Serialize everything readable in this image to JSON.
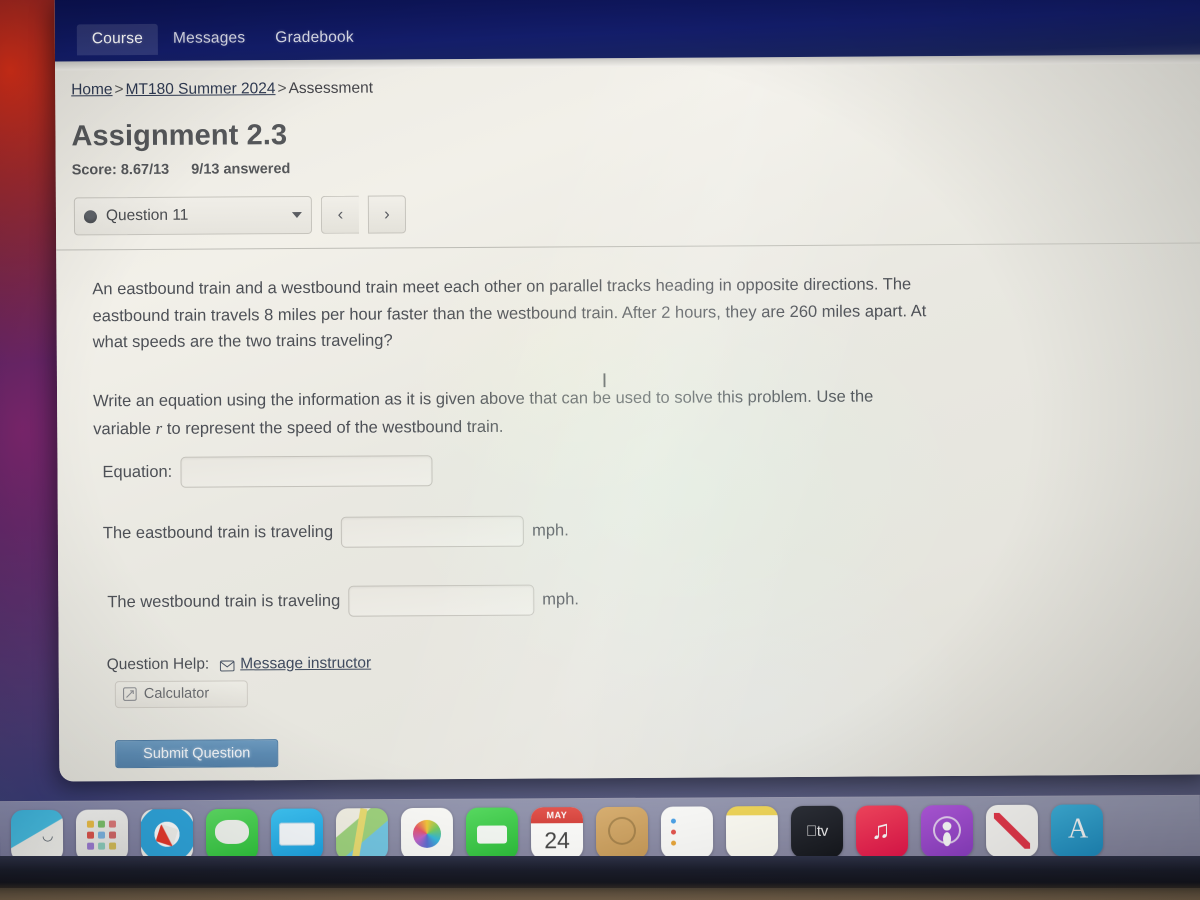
{
  "topnav": {
    "tabs": [
      {
        "label": "Course",
        "active": true
      },
      {
        "label": "Messages",
        "active": false
      },
      {
        "label": "Gradebook",
        "active": false
      }
    ]
  },
  "breadcrumb": {
    "home": "Home",
    "course": "MT180 Summer 2024",
    "current": "Assessment",
    "separator": ">"
  },
  "assignment": {
    "title": "Assignment 2.3",
    "score_label": "Score: 8.67/13",
    "answered_label": "9/13 answered"
  },
  "question_nav": {
    "selected_question": "Question 11",
    "prev_label": "‹",
    "next_label": "›",
    "dropdown_icon": "chevron-down-icon",
    "status_icon": "partial-credit-dot-icon"
  },
  "question": {
    "prompt_line_1": "An eastbound train and a westbound train meet each other on parallel tracks heading in",
    "prompt_line_2": "opposite directions. The eastbound train travels 8 miles per hour faster than the westbound",
    "prompt_line_3": "train. After 2 hours, they are 260 miles apart. At what speeds are the two trains traveling?",
    "instruction_part_1": "Write an equation using the information as it is given above that can be used to solve this problem. Use the variable ",
    "instruction_variable": "r",
    "instruction_part_2": " to represent the speed of the westbound train.",
    "equation_label": "Equation:",
    "equation_value": "",
    "equation_placeholder": "",
    "eastbound_label": "The eastbound train is traveling",
    "eastbound_value": "",
    "eastbound_unit": "mph.",
    "westbound_label": "The westbound train is traveling",
    "westbound_value": "",
    "westbound_unit": "mph.",
    "cursor_glyph": "I"
  },
  "help": {
    "help_label": "Question Help:",
    "message_instructor_label": "Message instructor",
    "message_icon": "envelope-icon",
    "calculator_label": "Calculator",
    "calculator_icon": "popout-square-icon"
  },
  "actions": {
    "submit_label": "Submit Question",
    "submit_color": "#5d8cb4"
  },
  "dock": {
    "items": [
      {
        "name": "finder",
        "label": "Finder",
        "icon": "finder-icon"
      },
      {
        "name": "launchpad",
        "label": "Launchpad",
        "icon": "launchpad-icon"
      },
      {
        "name": "safari",
        "label": "Safari",
        "icon": "safari-icon"
      },
      {
        "name": "messages",
        "label": "Messages",
        "icon": "messages-icon"
      },
      {
        "name": "mail",
        "label": "Mail",
        "icon": "mail-icon"
      },
      {
        "name": "maps",
        "label": "Maps",
        "icon": "maps-icon"
      },
      {
        "name": "photos",
        "label": "Photos",
        "icon": "photos-icon"
      },
      {
        "name": "facetime",
        "label": "FaceTime",
        "icon": "facetime-icon"
      },
      {
        "name": "calendar",
        "label": "Calendar",
        "icon": "calendar-icon",
        "month": "MAY",
        "day": "24"
      },
      {
        "name": "contacts",
        "label": "Contacts",
        "icon": "contacts-icon"
      },
      {
        "name": "reminders",
        "label": "Reminders",
        "icon": "reminders-icon"
      },
      {
        "name": "notes",
        "label": "Notes",
        "icon": "notes-icon"
      },
      {
        "name": "appletv",
        "label": "Apple TV",
        "icon": "appletv-icon",
        "text": "tv"
      },
      {
        "name": "music",
        "label": "Music",
        "icon": "music-icon"
      },
      {
        "name": "podcasts",
        "label": "Podcasts",
        "icon": "podcasts-icon"
      },
      {
        "name": "news",
        "label": "News",
        "icon": "news-icon"
      },
      {
        "name": "appstore",
        "label": "App Store",
        "icon": "appstore-icon"
      }
    ]
  }
}
